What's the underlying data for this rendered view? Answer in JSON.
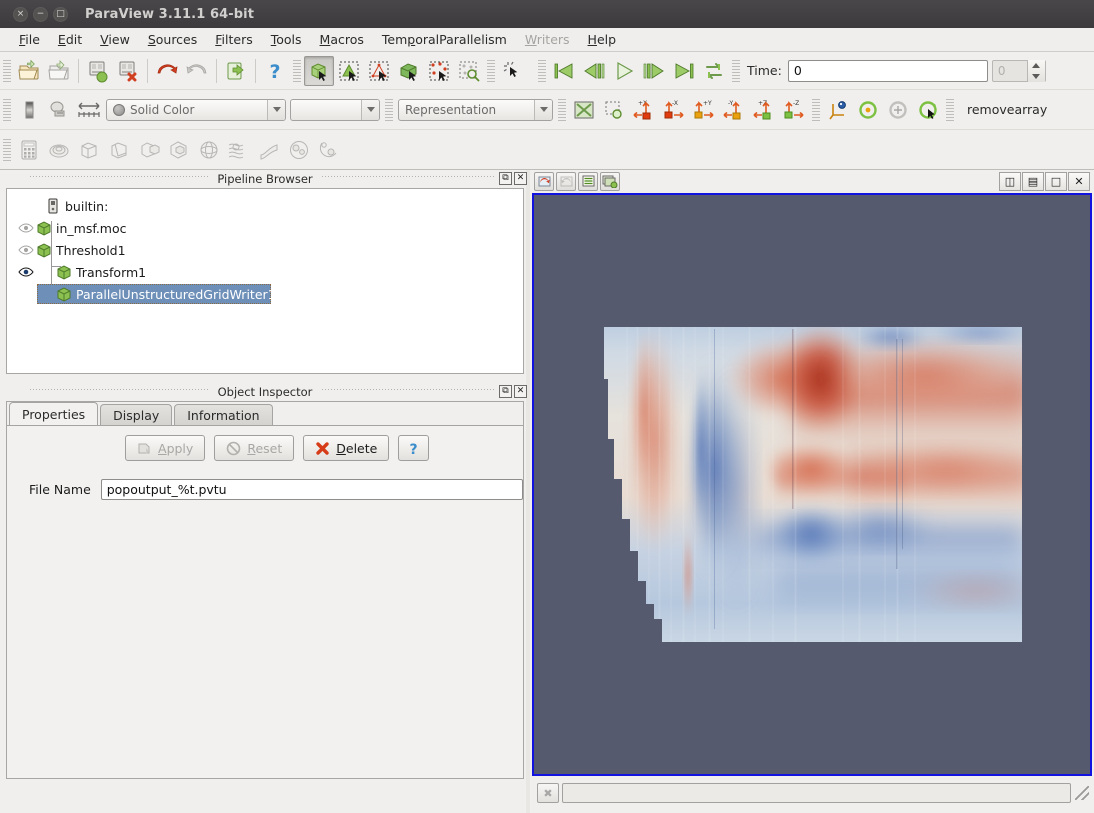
{
  "window": {
    "title": "ParaView 3.11.1 64-bit",
    "buttons": [
      {
        "name": "close",
        "glyph": "×"
      },
      {
        "name": "minimize",
        "glyph": "−"
      },
      {
        "name": "maximize",
        "glyph": "□"
      }
    ]
  },
  "menubar": {
    "items": [
      {
        "label": "File",
        "accel": "F",
        "disabled": false
      },
      {
        "label": "Edit",
        "accel": "E",
        "disabled": false
      },
      {
        "label": "View",
        "accel": "V",
        "disabled": false
      },
      {
        "label": "Sources",
        "accel": "S",
        "disabled": false
      },
      {
        "label": "Filters",
        "accel": "F",
        "disabled": false
      },
      {
        "label": "Tools",
        "accel": "T",
        "disabled": false
      },
      {
        "label": "Macros",
        "accel": "M",
        "disabled": false
      },
      {
        "label": "TemporalParallelism",
        "accel": "P",
        "disabled": false
      },
      {
        "label": "Writers",
        "accel": "W",
        "disabled": true
      },
      {
        "label": "Help",
        "accel": "H",
        "disabled": false
      }
    ]
  },
  "toolbar_main": {
    "icons": [
      "open-file-icon",
      "open-recent-icon",
      "save-state-icon",
      "delete-state-icon",
      "undo-icon",
      "redo-icon",
      "connect-server-icon",
      "help-icon"
    ],
    "selection_icons": [
      "select-surface-cells-icon",
      "select-surface-points-icon",
      "select-frustum-cells-icon",
      "select-frustum-points-icon",
      "select-block-icon",
      "select-points-through-icon",
      "hover-points-icon",
      "interactive-select-icon"
    ],
    "pressed_icon": "select-surface-cells-icon"
  },
  "vcr": {
    "icons": [
      "first-frame-icon",
      "previous-frame-icon",
      "play-icon",
      "next-frame-icon",
      "last-frame-icon",
      "loop-icon"
    ],
    "time_label": "Time:",
    "time_value": "0",
    "time_placeholder": "0",
    "frame_value": "0"
  },
  "toolbar_repr": {
    "color_icons": [
      "color-scale-icon",
      "edit-color-map-icon",
      "rescale-range-icon"
    ],
    "array_combo_value": "Solid Color",
    "component_combo_value": "",
    "representation_combo_value": "Representation",
    "camera_icons": [
      "reset-camera-icon",
      "zoom-to-box-icon",
      "view-neg-x-icon",
      "view-pos-x-icon",
      "view-pos-y-icon",
      "view-neg-y-icon",
      "view-pos-z-icon",
      "view-neg-z-icon"
    ],
    "rotate_icons": [
      "center-axes-icon",
      "rotate-90-ccw-icon",
      "reset-rotation-icon",
      "rotate-90-cw-icon"
    ],
    "status_text": "removearray"
  },
  "toolbar_filters": {
    "icons": [
      "calculator-icon",
      "contour-icon",
      "clip-icon",
      "slice-icon",
      "threshold-icon",
      "extract-subset-icon",
      "glyph-icon",
      "stream-tracer-icon",
      "warp-icon",
      "group-datasets-icon",
      "extract-level-icon"
    ],
    "all_disabled": true
  },
  "pipeline_browser": {
    "title": "Pipeline Browser",
    "dock_buttons": [
      "float-icon",
      "close-icon"
    ],
    "items": [
      {
        "label": "builtin:",
        "icon": "server-icon",
        "eye": "none",
        "indent": 0,
        "selected": false
      },
      {
        "label": "in_msf.moc",
        "icon": "source-icon",
        "eye": "hidden",
        "indent": 0,
        "selected": false
      },
      {
        "label": "Threshold1",
        "icon": "source-icon",
        "eye": "hidden",
        "indent": 0,
        "selected": false
      },
      {
        "label": "Transform1",
        "icon": "source-icon",
        "eye": "visible",
        "indent": 1,
        "selected": false
      },
      {
        "label": "ParallelUnstructuredGridWriter1",
        "icon": "source-icon",
        "eye": "none",
        "indent": 1,
        "selected": true
      }
    ]
  },
  "object_inspector": {
    "title": "Object Inspector",
    "dock_buttons": [
      "float-icon",
      "close-icon"
    ],
    "tabs": [
      {
        "label": "Properties",
        "active": true
      },
      {
        "label": "Display",
        "active": false
      },
      {
        "label": "Information",
        "active": false
      }
    ],
    "buttons": [
      {
        "label": "Apply",
        "accel": "A",
        "icon": "apply-icon",
        "disabled": true
      },
      {
        "label": "Reset",
        "accel": "R",
        "icon": "reset-icon",
        "disabled": true
      },
      {
        "label": "Delete",
        "accel": "D",
        "icon": "delete-icon",
        "disabled": false
      },
      {
        "label": "",
        "accel": "",
        "icon": "help-icon",
        "disabled": false
      }
    ],
    "properties": [
      {
        "label": "File Name",
        "value": "popoutput_%t.pvtu",
        "placeholder": ""
      }
    ]
  },
  "render_view": {
    "toolbar_left_icons": [
      "undo-camera-icon",
      "redo-camera-icon",
      "split-chart-icon",
      "capture-screenshot-icon"
    ],
    "toolbar_right_buttons": [
      {
        "name": "split-horizontal-button",
        "glyph": "◫"
      },
      {
        "name": "split-vertical-button",
        "glyph": "▤"
      },
      {
        "name": "maximize-view-button",
        "glyph": "□"
      },
      {
        "name": "close-view-button",
        "glyph": "✕"
      }
    ],
    "background_color": "#565a6e",
    "border_color": "#1313e0",
    "dataset_description": "2D unstructured grid slice colored with blue-white-red diverging colormap (MOC streamfunction field)",
    "colormap": {
      "name": "blue-white-red",
      "low_color": "#3b4cc0",
      "mid_color": "#f2f2f2",
      "high_color": "#b40426"
    }
  },
  "status_bar": {
    "abort_button_icon": "abort-icon",
    "progress_value": 0,
    "message": ""
  }
}
